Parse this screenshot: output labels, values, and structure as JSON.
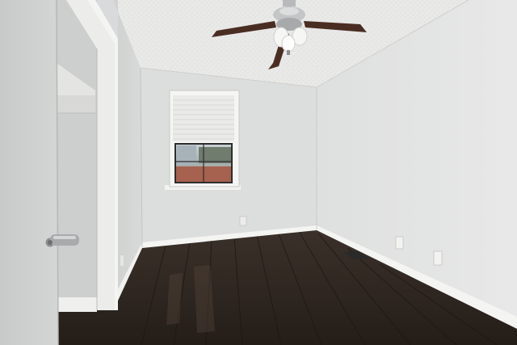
{
  "scene": {
    "description_free": true,
    "palette": {
      "ceiling": "#e9e9e8",
      "back_wall": "#dcdddd",
      "right_wall": "#e3e3e3",
      "left_wall": "#d2d3d3",
      "floor_dark": "#2c2520",
      "floor_light": "#4a3e35",
      "trim": "#f4f4f2",
      "door": "#cfd0d0",
      "fan_blade": "#4a2d22",
      "metal": "#a9aaab"
    },
    "icons": [
      "ceiling-fan-icon",
      "window-icon",
      "door-handle-icon",
      "outlet-icon",
      "floor-vent-icon"
    ]
  }
}
